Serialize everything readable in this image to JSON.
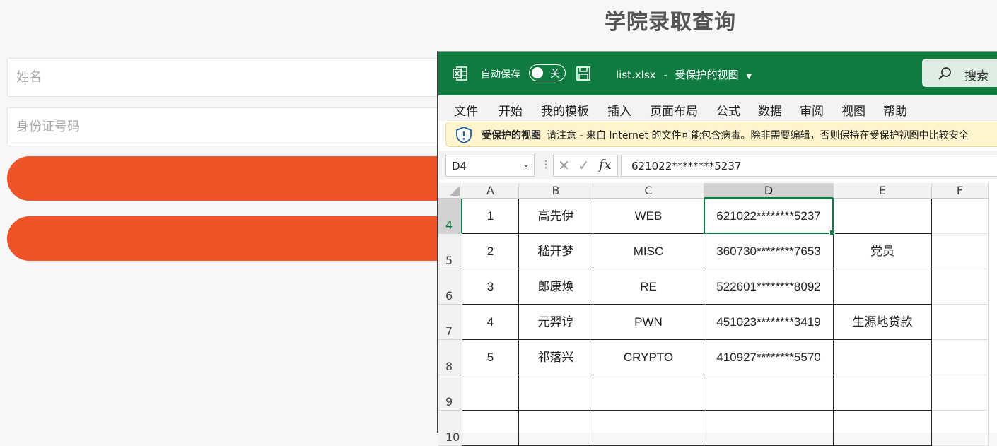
{
  "page": {
    "title": "学院录取查询",
    "name_placeholder": "姓名",
    "id_placeholder": "身份证号码"
  },
  "excel": {
    "autosave_label": "自动保存",
    "autosave_state": "关",
    "filename": "list.xlsx",
    "separator": "-",
    "view_mode": "受保护的视图",
    "search_label": "搜索",
    "menu": [
      "文件",
      "开始",
      "我的模板",
      "插入",
      "页面布局",
      "公式",
      "数据",
      "审阅",
      "视图",
      "帮助"
    ],
    "protected_view": {
      "title": "受保护的视图",
      "message": "请注意 - 来自 Internet 的文件可能包含病毒。除非需要编辑，否则保持在受保护视图中比较安全"
    },
    "name_box": "D4",
    "formula_value": "621022********5237",
    "columns": [
      "A",
      "B",
      "C",
      "D",
      "E",
      "F"
    ],
    "selected_column": "D",
    "rows": [
      {
        "num": "4",
        "cells": [
          "1",
          "高先伊",
          "WEB",
          "621022********5237",
          "",
          ""
        ]
      },
      {
        "num": "5",
        "cells": [
          "2",
          "嵇开梦",
          "MISC",
          "360730********7653",
          "党员",
          ""
        ]
      },
      {
        "num": "6",
        "cells": [
          "3",
          "郎康焕",
          "RE",
          "522601********8092",
          "",
          ""
        ]
      },
      {
        "num": "7",
        "cells": [
          "4",
          "元羿谆",
          "PWN",
          "451023********3419",
          "生源地贷款",
          ""
        ]
      },
      {
        "num": "8",
        "cells": [
          "5",
          "祁落兴",
          "CRYPTO",
          "410927********5570",
          "",
          ""
        ]
      },
      {
        "num": "9",
        "cells": [
          "",
          "",
          "",
          "",
          "",
          ""
        ]
      },
      {
        "num": "10",
        "cells": [
          "",
          "",
          "",
          "",
          "",
          ""
        ]
      }
    ],
    "selected_row": "4",
    "accent_color": "#0f7b40"
  },
  "colors": {
    "button": "#ee5427"
  }
}
